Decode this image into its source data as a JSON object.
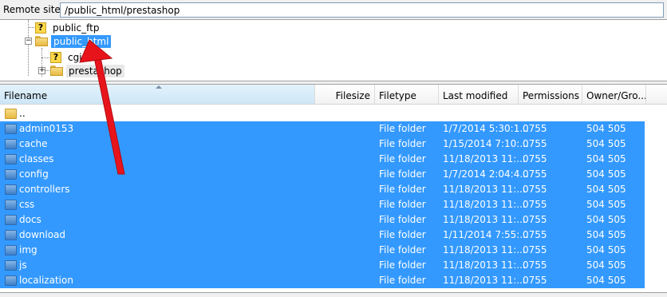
{
  "remote_site": {
    "label": "Remote site:",
    "path": "/public_html/prestashop"
  },
  "tree": [
    {
      "label": "public_ftp",
      "icon": "question-icon",
      "state": "normal"
    },
    {
      "label": "public_html",
      "icon": "folder-icon",
      "state": "selected"
    },
    {
      "label": "cgi-b",
      "icon": "question-icon",
      "state": "normal"
    },
    {
      "label": "prestashop",
      "icon": "folder-icon",
      "state": "highlighted"
    }
  ],
  "columns": [
    "Filename",
    "Filesize",
    "Filetype",
    "Last modified",
    "Permissions",
    "Owner/Gro..."
  ],
  "parent_row": "..",
  "files": [
    {
      "name": "admin0153",
      "type": "File folder",
      "modified": "1/7/2014 5:30:1...",
      "perms": "0755",
      "owner": "504 505"
    },
    {
      "name": "cache",
      "type": "File folder",
      "modified": "1/15/2014 7:10:...",
      "perms": "0755",
      "owner": "504 505"
    },
    {
      "name": "classes",
      "type": "File folder",
      "modified": "11/18/2013 11:...",
      "perms": "0755",
      "owner": "504 505"
    },
    {
      "name": "config",
      "type": "File folder",
      "modified": "1/7/2014 2:04:4...",
      "perms": "0755",
      "owner": "504 505"
    },
    {
      "name": "controllers",
      "type": "File folder",
      "modified": "11/18/2013 11:...",
      "perms": "0755",
      "owner": "504 505"
    },
    {
      "name": "css",
      "type": "File folder",
      "modified": "11/18/2013 11:...",
      "perms": "0755",
      "owner": "504 505"
    },
    {
      "name": "docs",
      "type": "File folder",
      "modified": "11/18/2013 11:...",
      "perms": "0755",
      "owner": "504 505"
    },
    {
      "name": "download",
      "type": "File folder",
      "modified": "1/11/2014 7:55:...",
      "perms": "0755",
      "owner": "504 505"
    },
    {
      "name": "img",
      "type": "File folder",
      "modified": "11/18/2013 11:...",
      "perms": "0755",
      "owner": "504 505"
    },
    {
      "name": "js",
      "type": "File folder",
      "modified": "11/18/2013 11:...",
      "perms": "0755",
      "owner": "504 505"
    },
    {
      "name": "localization",
      "type": "File folder",
      "modified": "11/18/2013 11:...",
      "perms": "0755",
      "owner": "504 505"
    }
  ],
  "colors": {
    "selection": "#3399ff",
    "annotation_arrow": "#e8141c"
  }
}
